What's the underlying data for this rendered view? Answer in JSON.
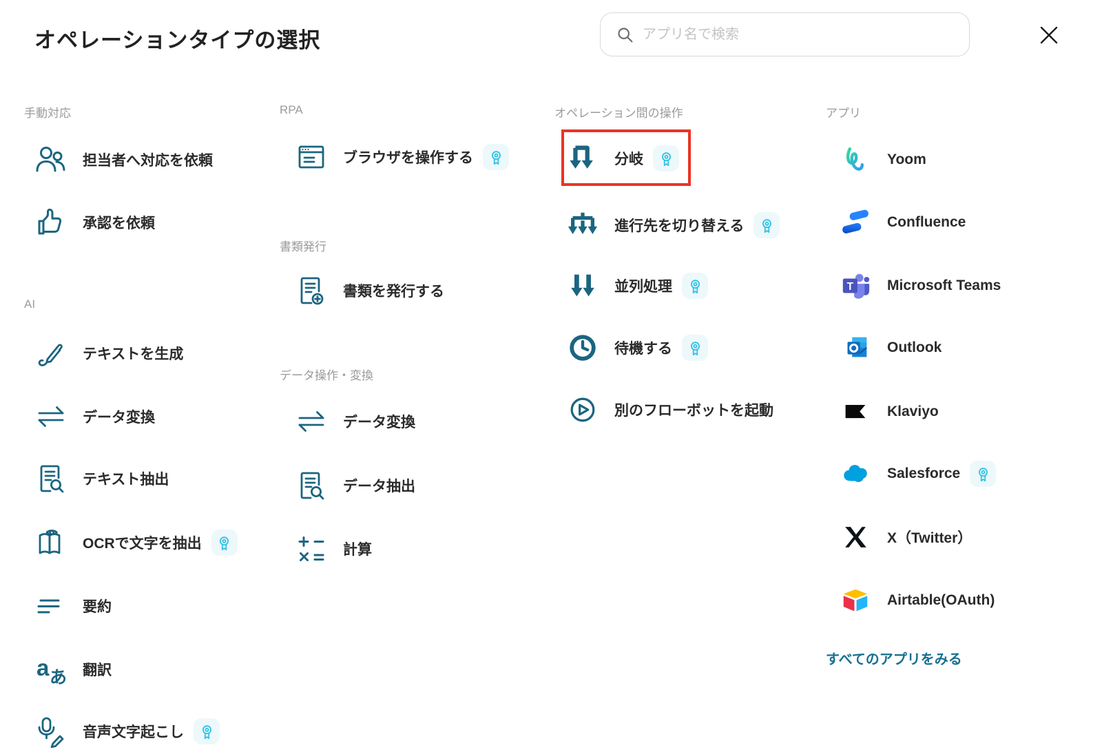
{
  "modal": {
    "title": "オペレーションタイプの選択",
    "search_placeholder": "アプリ名で検索"
  },
  "colors": {
    "icon_teal": "#1b6580",
    "badge_cyan": "#2ec2e5",
    "badge_bg": "#edf8fb",
    "highlight_red": "#ea3423",
    "link_teal": "#17708f",
    "section_gray": "#9b9b9b",
    "text_dark": "#2b2b2b"
  },
  "sections": {
    "manual": {
      "header": "手動対応",
      "items": [
        {
          "label": "担当者へ対応を依頼",
          "icon": "people-icon",
          "badge": false
        },
        {
          "label": "承認を依頼",
          "icon": "thumbs-up-icon",
          "badge": false
        }
      ]
    },
    "ai": {
      "header": "AI",
      "items": [
        {
          "label": "テキストを生成",
          "icon": "pen-squiggle-icon",
          "badge": false
        },
        {
          "label": "データ変換",
          "icon": "swap-arrows-icon",
          "badge": false
        },
        {
          "label": "テキスト抽出",
          "icon": "document-search-icon",
          "badge": false
        },
        {
          "label": "OCRで文字を抽出",
          "icon": "book-eye-icon",
          "badge": true
        },
        {
          "label": "要約",
          "icon": "summary-lines-icon",
          "badge": false
        },
        {
          "label": "翻訳",
          "icon": "translate-icon",
          "badge": false
        },
        {
          "label": "音声文字起こし",
          "icon": "mic-pencil-icon",
          "badge": true
        }
      ]
    },
    "rpa": {
      "header": "RPA",
      "items": [
        {
          "label": "ブラウザを操作する",
          "icon": "browser-icon",
          "badge": true
        }
      ]
    },
    "docs": {
      "header": "書類発行",
      "items": [
        {
          "label": "書類を発行する",
          "icon": "document-plus-icon",
          "badge": false
        }
      ]
    },
    "dataops": {
      "header": "データ操作・変換",
      "items": [
        {
          "label": "データ変換",
          "icon": "swap-arrows-icon",
          "badge": false
        },
        {
          "label": "データ抽出",
          "icon": "document-search-icon",
          "badge": false
        },
        {
          "label": "計算",
          "icon": "calculator-icon",
          "badge": false
        }
      ]
    },
    "flowops": {
      "header": "オペレーション間の操作",
      "items": [
        {
          "label": "分岐",
          "icon": "branch-icon",
          "badge": true,
          "highlighted": true
        },
        {
          "label": "進行先を切り替える",
          "icon": "switch-branch-icon",
          "badge": true
        },
        {
          "label": "並列処理",
          "icon": "parallel-arrows-icon",
          "badge": true
        },
        {
          "label": "待機する",
          "icon": "clock-icon",
          "badge": true
        },
        {
          "label": "別のフローボットを起動",
          "icon": "play-circle-icon",
          "badge": false
        }
      ]
    },
    "apps": {
      "header": "アプリ",
      "items": [
        {
          "label": "Yoom",
          "icon": "yoom-logo"
        },
        {
          "label": "Confluence",
          "icon": "confluence-logo"
        },
        {
          "label": "Microsoft Teams",
          "icon": "teams-logo"
        },
        {
          "label": "Outlook",
          "icon": "outlook-logo"
        },
        {
          "label": "Klaviyo",
          "icon": "klaviyo-logo"
        },
        {
          "label": "Salesforce",
          "icon": "salesforce-logo",
          "badge": true
        },
        {
          "label": "X（Twitter）",
          "icon": "x-logo"
        },
        {
          "label": "Airtable(OAuth)",
          "icon": "airtable-logo"
        }
      ],
      "footer_link": "すべてのアプリをみる"
    }
  }
}
